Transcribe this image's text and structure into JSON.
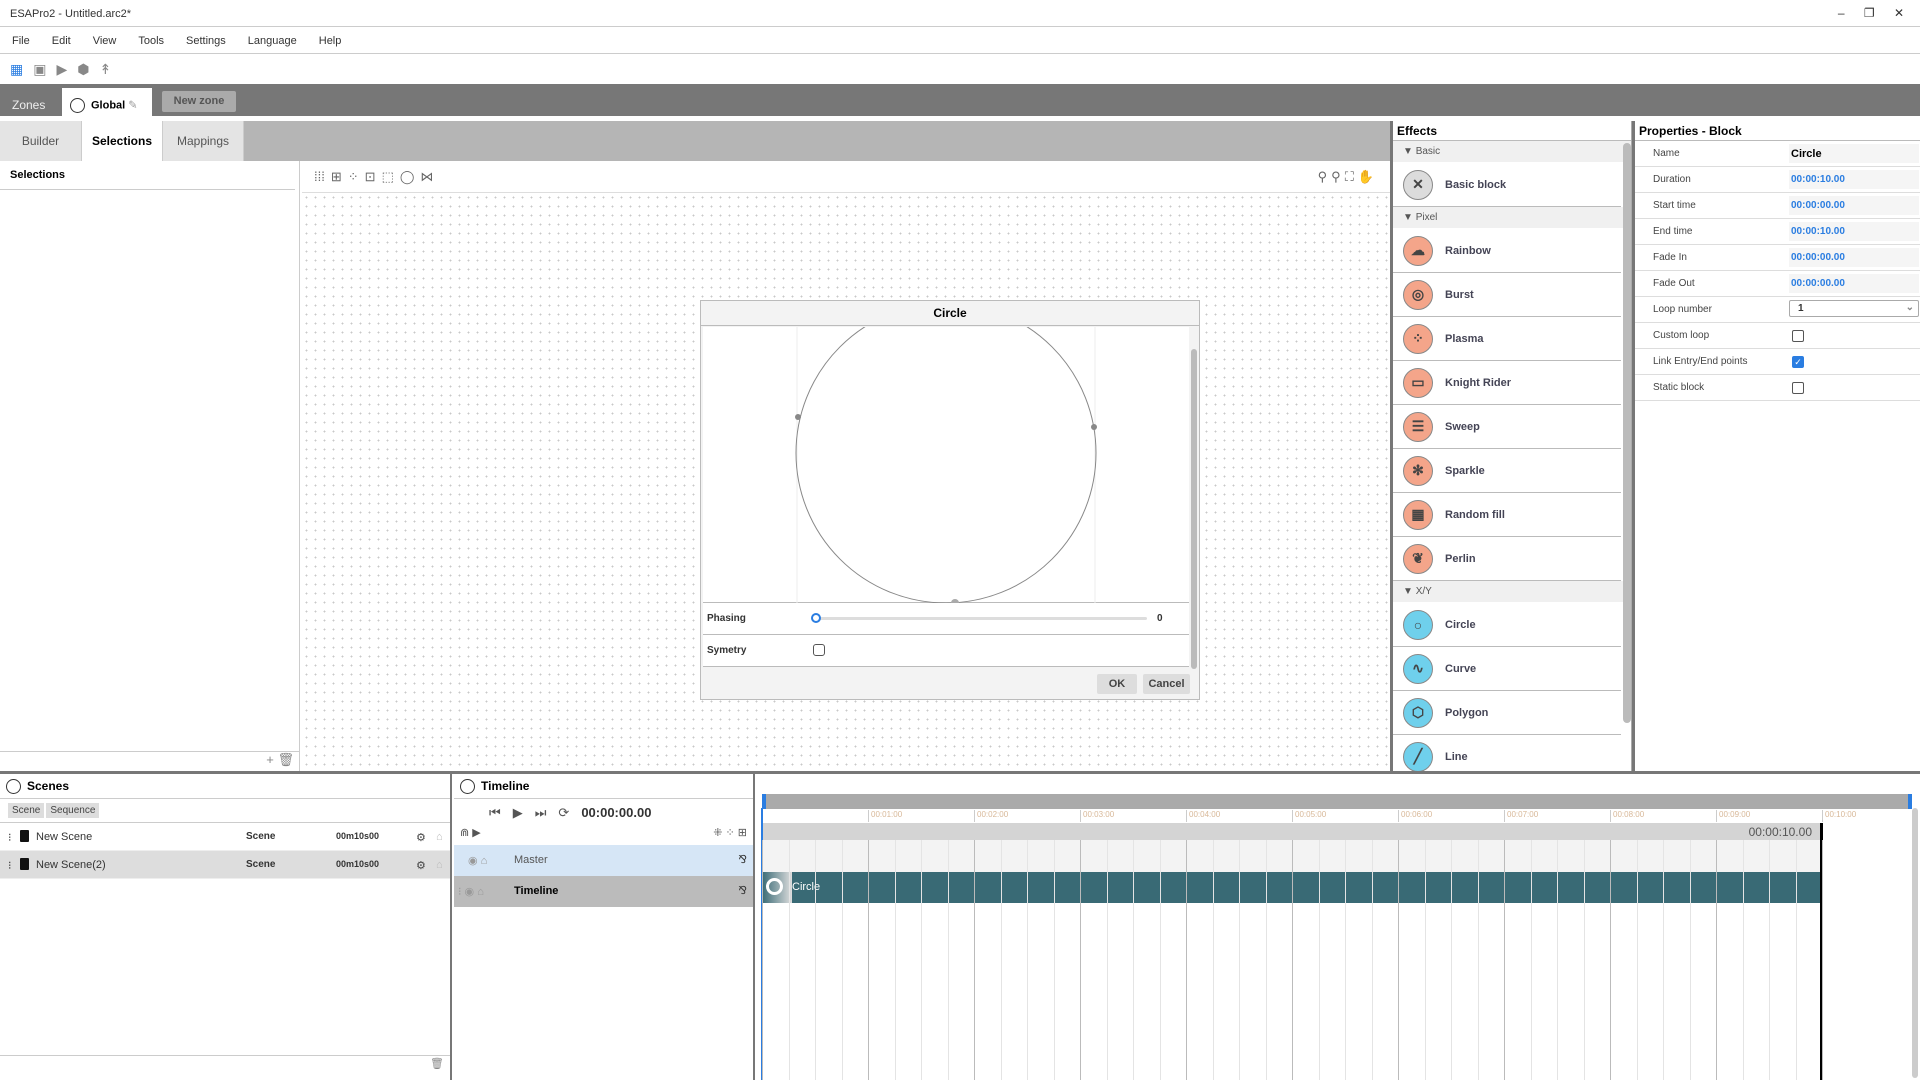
{
  "window": {
    "title": "ESAPro2 - Untitled.arc2*",
    "controls": "‒ ❐ ✕"
  },
  "menu": [
    "File",
    "Edit",
    "View",
    "Tools",
    "Settings",
    "Language",
    "Help"
  ],
  "toolbar_icons": [
    "grid-icon",
    "save-icon",
    "play-icon",
    "package-icon",
    "pointer-icon"
  ],
  "zones": {
    "label": "Zones",
    "active": "Global",
    "new_zone": "New zone"
  },
  "tabs": [
    "Builder",
    "Selections",
    "Mappings"
  ],
  "selections": {
    "title": "Selections",
    "add": "+",
    "delete": "🗑"
  },
  "dialog": {
    "title": "Circle",
    "phasing_label": "Phasing",
    "phasing_value": "0",
    "phasing_fraction": 0,
    "symetry_label": "Symetry",
    "symetry_checked": false,
    "ok": "OK",
    "cancel": "Cancel"
  },
  "effects": {
    "title": "Effects",
    "sections": [
      {
        "name": "Basic",
        "items": [
          {
            "label": "Basic block",
            "icon": "✕",
            "color": "#dcdcdc"
          }
        ]
      },
      {
        "name": "Pixel",
        "items": [
          {
            "label": "Rainbow",
            "icon": "☁",
            "color": "#f4a58a"
          },
          {
            "label": "Burst",
            "icon": "◎",
            "color": "#f4a58a"
          },
          {
            "label": "Plasma",
            "icon": "⁘",
            "color": "#f4a58a"
          },
          {
            "label": "Knight Rider",
            "icon": "▭",
            "color": "#f4a58a"
          },
          {
            "label": "Sweep",
            "icon": "☰",
            "color": "#f4a58a"
          },
          {
            "label": "Sparkle",
            "icon": "✻",
            "color": "#f4a58a"
          },
          {
            "label": "Random fill",
            "icon": "▦",
            "color": "#f4a58a"
          },
          {
            "label": "Perlin",
            "icon": "❦",
            "color": "#f4a58a"
          }
        ]
      },
      {
        "name": "X/Y",
        "items": [
          {
            "label": "Circle",
            "icon": "○",
            "color": "#6fd0ec"
          },
          {
            "label": "Curve",
            "icon": "∿",
            "color": "#6fd0ec"
          },
          {
            "label": "Polygon",
            "icon": "⬡",
            "color": "#6fd0ec"
          },
          {
            "label": "Line",
            "icon": "╱",
            "color": "#6fd0ec"
          }
        ]
      }
    ]
  },
  "properties": {
    "title": "Properties - Block",
    "rows": [
      {
        "label": "Name",
        "value": "Circle"
      },
      {
        "label": "Duration",
        "value": "00:00:10.00"
      },
      {
        "label": "Start time",
        "value": "00:00:00.00"
      },
      {
        "label": "End time",
        "value": "00:00:10.00"
      },
      {
        "label": "Fade In",
        "value": "00:00:00.00"
      },
      {
        "label": "Fade Out",
        "value": "00:00:00.00"
      }
    ],
    "loop_label": "Loop number",
    "loop_value": "1",
    "checks": [
      {
        "label": "Custom loop",
        "checked": false
      },
      {
        "label": "Link Entry/End points",
        "checked": true
      },
      {
        "label": "Static block",
        "checked": false
      }
    ]
  },
  "scenes": {
    "title": "Scenes",
    "buttons": [
      "Scene",
      "Sequence"
    ],
    "rows": [
      {
        "name": "New Scene",
        "type": "Scene",
        "duration": "00m10s00"
      },
      {
        "name": "New Scene(2)",
        "type": "Scene",
        "duration": "00m10s00"
      }
    ]
  },
  "timeline": {
    "title": "Timeline",
    "time": "00:00:00.00",
    "tracks": [
      "Master",
      "Timeline"
    ],
    "ticks": [
      "00:01:00",
      "00:02:00",
      "00:03:00",
      "00:04:00",
      "00:05:00",
      "00:06:00",
      "00:07:00",
      "00:08:00",
      "00:09:00",
      "00:10:00"
    ],
    "end_time": "00:00:10.00",
    "block_label": "Circle"
  }
}
